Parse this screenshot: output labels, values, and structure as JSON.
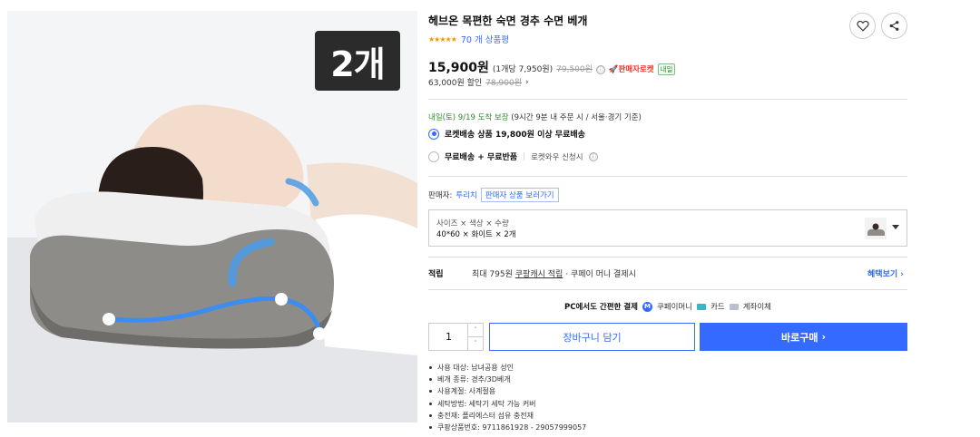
{
  "product_image": {
    "qty_badge": "2개"
  },
  "product": {
    "title": "헤브온 목편한 숙면 경추 수면 베개",
    "rating": {
      "stars": "★★★★★",
      "review_count_text": "70 개 상품평"
    }
  },
  "price": {
    "main": "15,900원",
    "unit_price": "(1개당 7,950원)",
    "original": "79,500원",
    "info_icon": "ⓘ",
    "seller_rocket": "🚀판매자로켓",
    "tomorrow_badge": "내일"
  },
  "discount": {
    "amount_text": "63,000원 할인",
    "original": "78,900원",
    "chevron": "›"
  },
  "delivery": {
    "arrival_date": "내일(토) 9/19",
    "guarantee": "도착 보장",
    "condition": "(9시간 9분 내 주문 시 / 서울·경기 기준)"
  },
  "shipping_options": [
    {
      "label": "로켓배송 상품 19,800원 이상 무료배송",
      "selected": true
    },
    {
      "label": "무료배송 + 무료반품",
      "note": "로켓와우 신청시",
      "selected": false
    }
  ],
  "seller": {
    "label": "판매자:",
    "name": "투리치",
    "link_text": "판매자 상품 보러가기"
  },
  "option": {
    "label": "사이즈 × 색상 × 수량",
    "value": "40*60 × 화이트 × 2개"
  },
  "points": {
    "label": "적립",
    "prefix": "최대 795원",
    "link": "쿠팡캐시 적립",
    "suffix": "· 쿠페이 머니 결제시",
    "benefits_link": "혜택보기 ›"
  },
  "payment": {
    "lead": "PC에서도 간편한 결제",
    "coupay_icon": "M",
    "methods": [
      "쿠페이머니",
      "카드",
      "계좌이체"
    ]
  },
  "purchase": {
    "quantity": "1",
    "up_arrow": "˄",
    "down_arrow": "˅",
    "cart_label": "장바구니 담기",
    "buy_label": "바로구매",
    "buy_chevron": "›"
  },
  "specs": [
    "사용 대상: 남녀공용 성인",
    "베개 종류: 경추/3D베개",
    "사용계절: 사계절용",
    "세탁방법: 세탁기 세탁 가능 커버",
    "충전재: 폴리에스터 섬유 충전재",
    "쿠팡상품번호: 9711861928 - 29057999057"
  ],
  "icons": {
    "wishlist": "heart-icon",
    "share": "share-icon"
  }
}
